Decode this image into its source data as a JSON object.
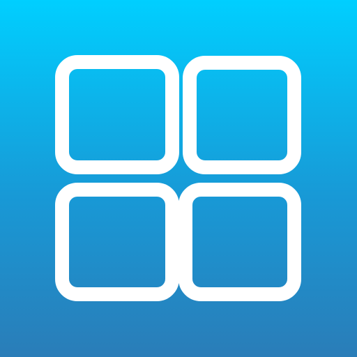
{
  "icon": {
    "name": "grid-app-icon",
    "glyph": "four-square-grid-icon",
    "tiles": [
      "tile-top-left",
      "tile-top-right",
      "tile-bottom-left",
      "tile-bottom-right"
    ],
    "colors": {
      "gradient_top": "#00cfff",
      "gradient_mid": "#1899d6",
      "gradient_bottom": "#2a7db8",
      "glyph": "#ffffff"
    }
  }
}
